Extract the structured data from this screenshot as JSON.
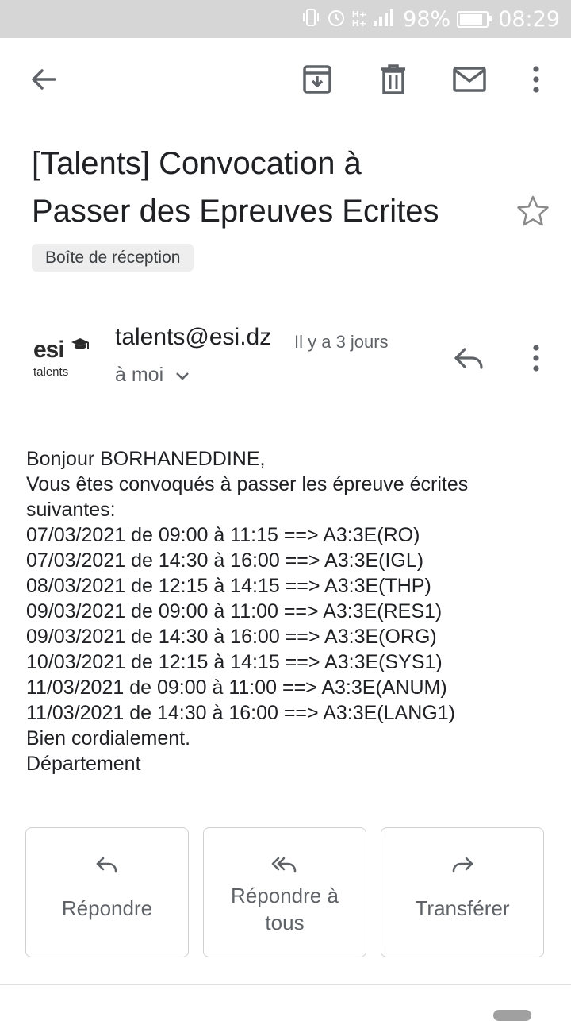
{
  "status_bar": {
    "battery": "98%",
    "battery_level": 0.98,
    "time": "08:29",
    "network": "H+"
  },
  "toolbar": {
    "icons": [
      "back-arrow-icon",
      "archive-icon",
      "delete-icon",
      "mark-unread-icon",
      "more-vert-icon"
    ]
  },
  "email": {
    "subject_line1": "[Talents] Convocation à",
    "subject_line2": "Passer des Epreuves Ecrites",
    "label": "Boîte de réception",
    "sender": "talents@esi.dz",
    "time": "Il y a 3 jours",
    "recipient": "à moi",
    "avatar": {
      "logo_main": "esi",
      "logo_sub": "talents"
    },
    "body": [
      "Bonjour BORHANEDDINE,",
      "Vous êtes convoqués à passer les épreuve écrites",
      "suivantes:",
      "07/03/2021 de 09:00 à 11:15 ==> A3:3E(RO)",
      "07/03/2021 de 14:30 à 16:00 ==> A3:3E(IGL)",
      "08/03/2021 de 12:15 à 14:15 ==> A3:3E(THP)",
      "09/03/2021 de 09:00 à 11:00 ==> A3:3E(RES1)",
      "09/03/2021 de 14:30 à 16:00 ==> A3:3E(ORG)",
      "10/03/2021 de 12:15 à 14:15 ==> A3:3E(SYS1)",
      "11/03/2021 de 09:00 à 11:00 ==> A3:3E(ANUM)",
      "11/03/2021 de 14:30 à 16:00 ==> A3:3E(LANG1)",
      "Bien cordialement.",
      "Département"
    ]
  },
  "actions": {
    "reply": "Répondre",
    "reply_all_line1": "Répondre à",
    "reply_all_line2": "tous",
    "forward": "Transférer"
  },
  "colors": {
    "status_bar": "#d6d6d6",
    "icon": "#5f6368",
    "text": "#202124",
    "chip": "#eeeeee"
  }
}
